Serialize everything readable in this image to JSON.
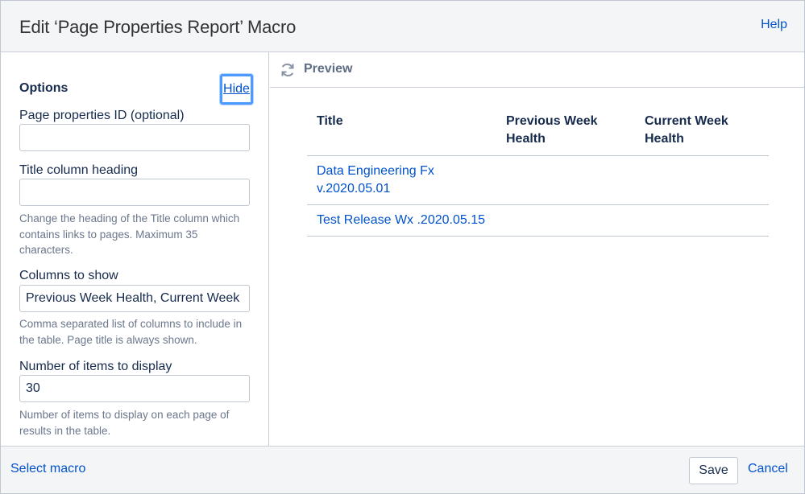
{
  "header": {
    "title": "Edit ‘Page Properties Report’ Macro",
    "help_label": "Help"
  },
  "options": {
    "heading": "Options",
    "hide_label": "Hide",
    "fields": [
      {
        "label": "Page properties ID (optional)",
        "value": "",
        "placeholder": ""
      },
      {
        "label": "Title column heading",
        "value": "",
        "placeholder": "",
        "description": "Change the heading of the Title column which contains links to pages. Maximum 35 characters."
      },
      {
        "label": "Columns to show",
        "value": "Previous Week Health, Current Week Health",
        "description": "Comma separated list of columns to include in the table. Page title is always shown."
      },
      {
        "label": "Number of items to display",
        "value": "30",
        "description": "Number of items to display on each page of results in the table."
      }
    ]
  },
  "preview": {
    "label": "Preview",
    "icon": "refresh-icon",
    "table": {
      "headers": [
        "Title",
        "Previous Week Health",
        "Current Week Health"
      ],
      "rows": [
        [
          "Data Engineering Fx v.2020.05.01",
          "",
          ""
        ],
        [
          "Test Release Wx .2020.05.15",
          "",
          ""
        ]
      ]
    }
  },
  "footer": {
    "select_macro_label": "Select macro",
    "save_label": "Save",
    "cancel_label": "Cancel"
  },
  "colors": {
    "link": "#0052cc",
    "focus_ring": "#4c9aff",
    "header_bg": "#f4f5f7",
    "text": "#172b4d",
    "muted": "#6b778c"
  }
}
